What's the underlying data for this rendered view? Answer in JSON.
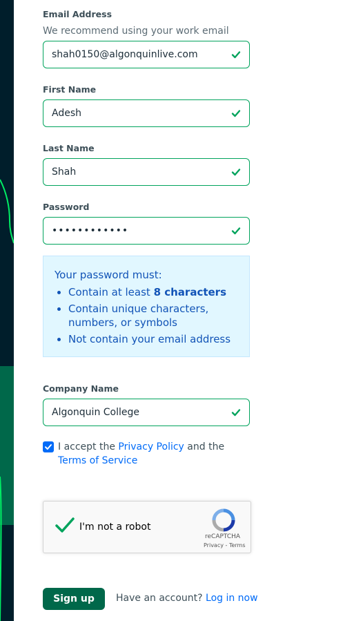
{
  "email": {
    "label": "Email Address",
    "hint": "We recommend using your work email",
    "value": "shah0150@algonquinlive.com"
  },
  "first_name": {
    "label": "First Name",
    "value": "Adesh"
  },
  "last_name": {
    "label": "Last Name",
    "value": "Shah"
  },
  "password": {
    "label": "Password",
    "value": "••••••••••••",
    "requirements_title": "Your password must:",
    "req1_prefix": "Contain at least ",
    "req1_bold": "8 characters",
    "req2": "Contain unique characters, numbers, or symbols",
    "req3": "Not contain your email address"
  },
  "company": {
    "label": "Company Name",
    "value": "Algonquin College"
  },
  "consent": {
    "checked": true,
    "prefix": "I accept the ",
    "privacy_link": "Privacy Policy",
    "middle": " and the ",
    "terms_link": "Terms of Service"
  },
  "recaptcha": {
    "label": "I'm not a robot",
    "brand": "reCAPTCHA",
    "privacy": "Privacy",
    "separator": " - ",
    "terms": "Terms"
  },
  "footer": {
    "signup_label": "Sign up",
    "have_account": "Have an account?",
    "login_link": "Log in now"
  },
  "colors": {
    "valid_green": "#00a35c",
    "link_blue": "#016bf8",
    "primary_button": "#00684a",
    "info_bg": "#e1f7ff"
  }
}
